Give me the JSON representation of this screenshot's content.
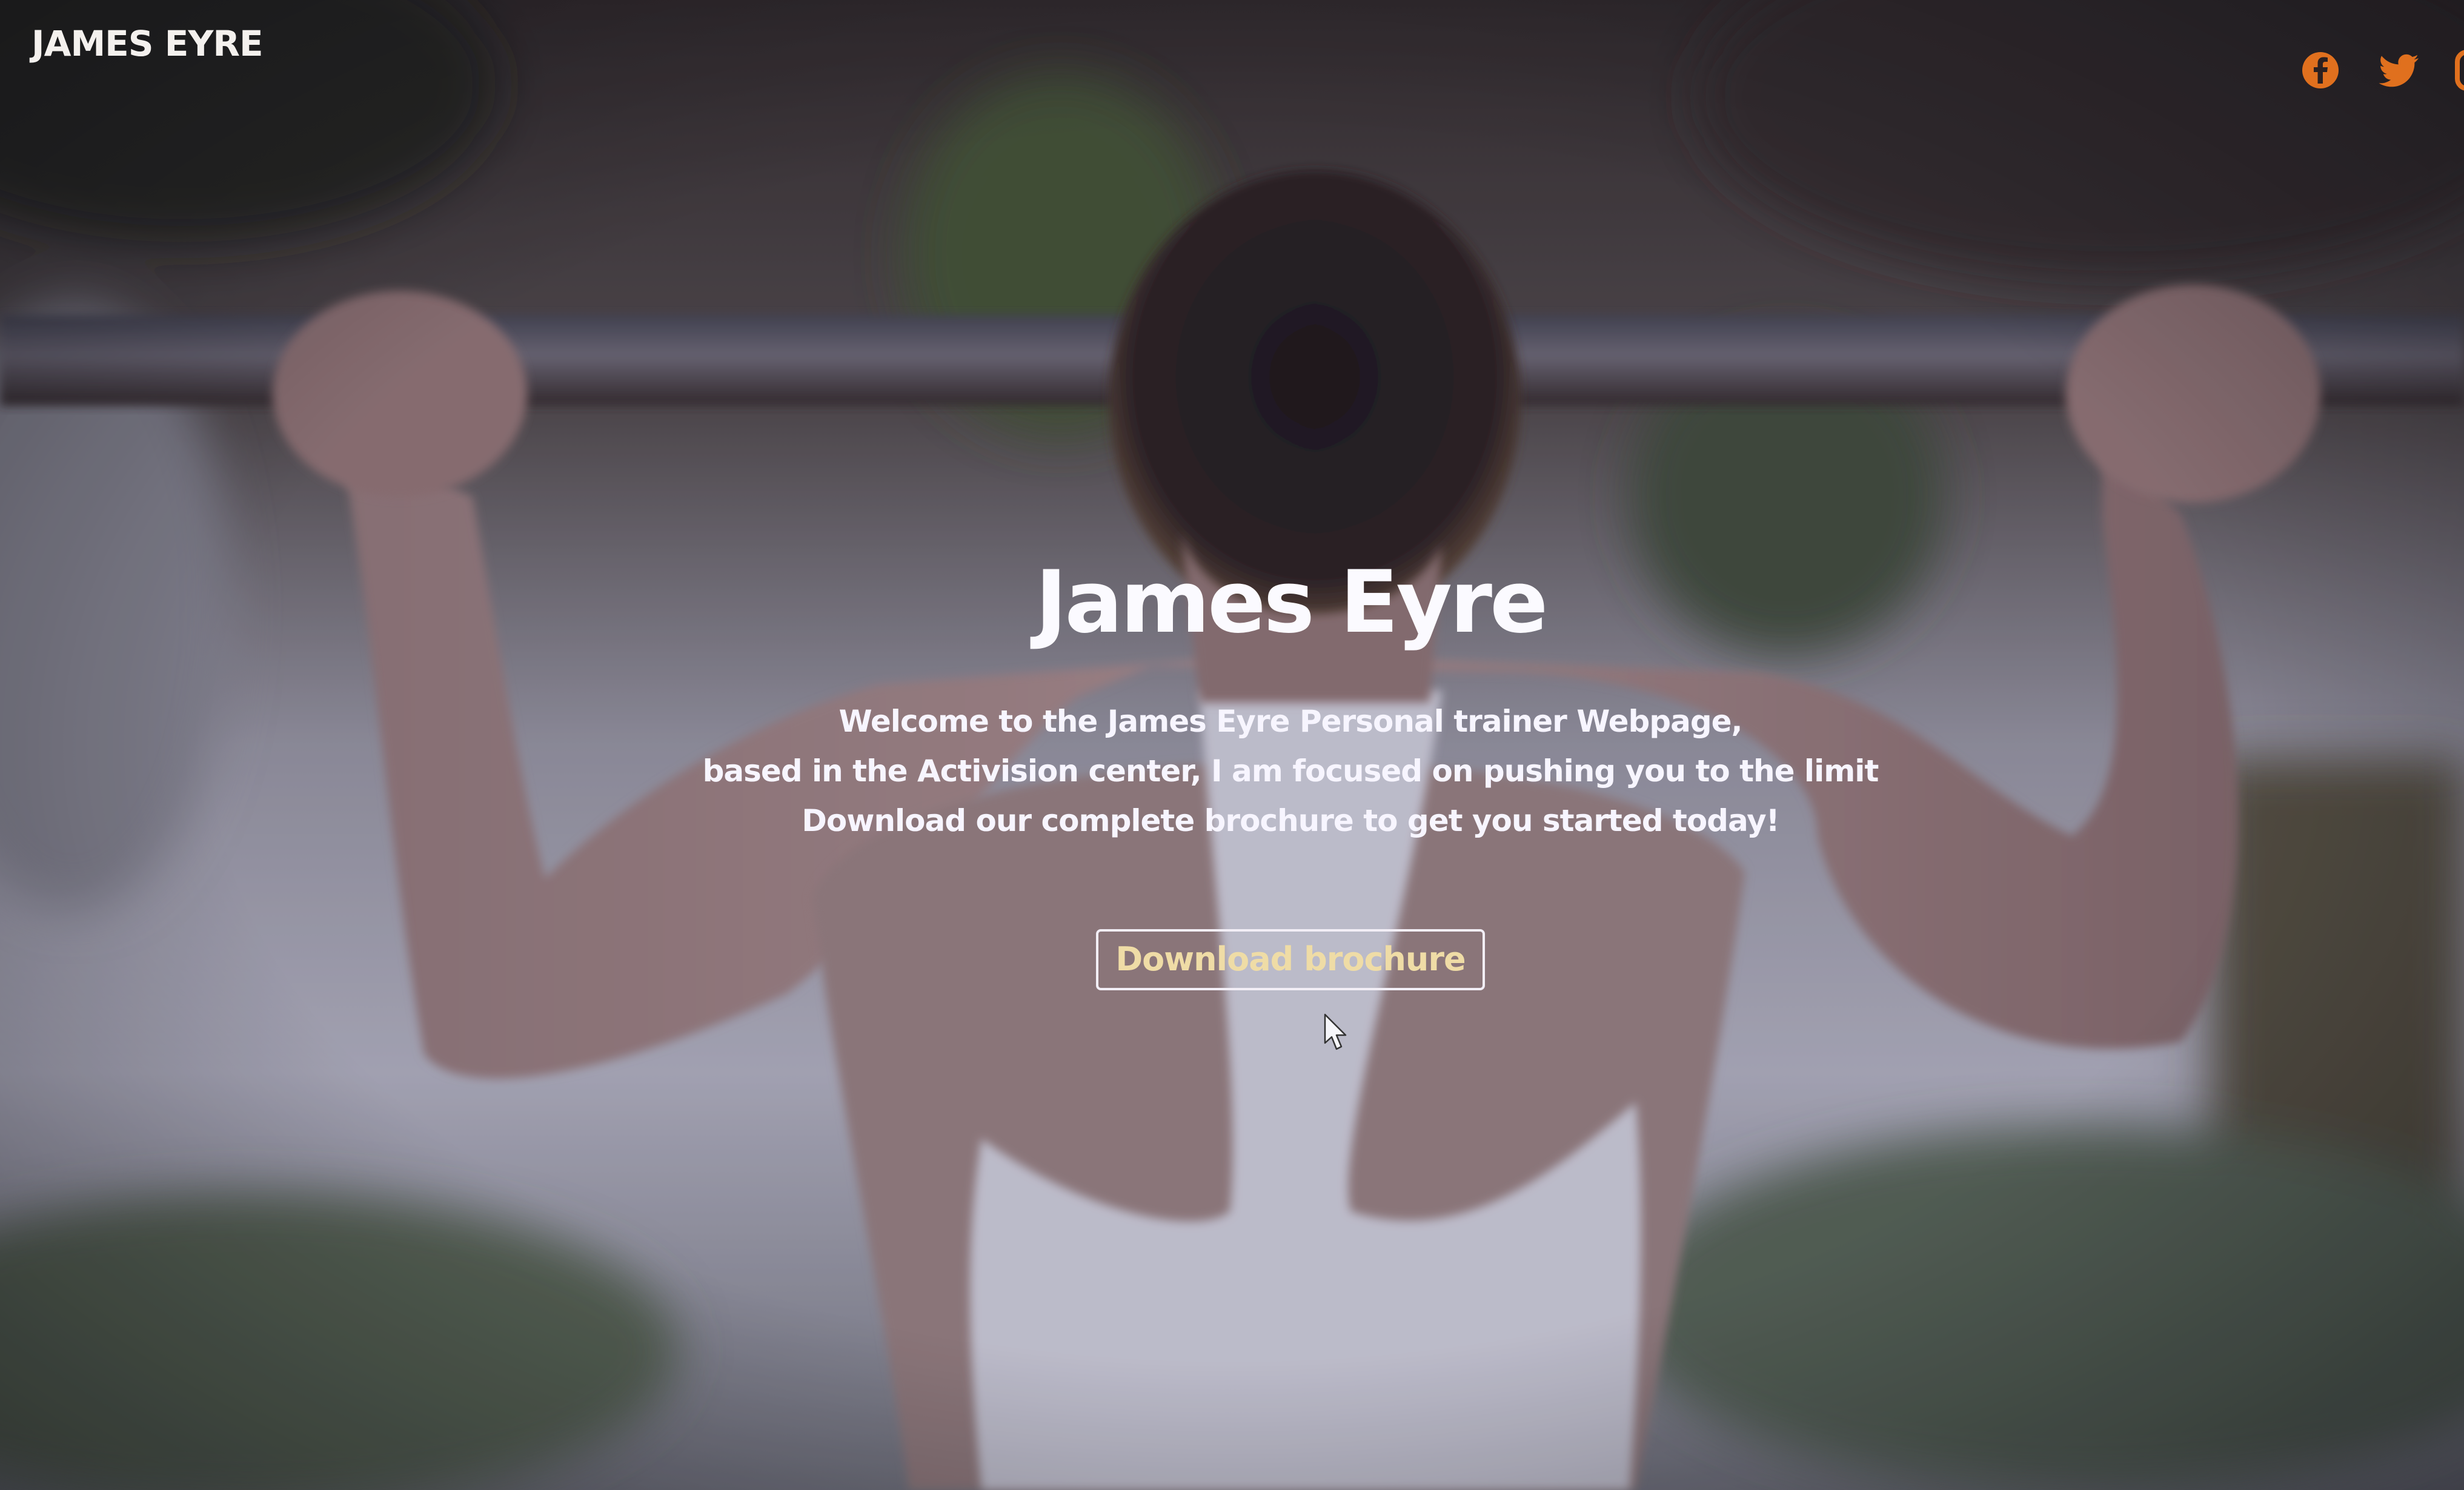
{
  "header": {
    "brand": "JAMES EYRE",
    "social": [
      {
        "network": "facebook",
        "icon": "facebook-icon"
      },
      {
        "network": "twitter",
        "icon": "twitter-icon"
      },
      {
        "network": "instagram",
        "icon": "instagram-icon"
      }
    ],
    "icon_color": "#e0701e"
  },
  "hero": {
    "title": "James Eyre",
    "lines": [
      "Welcome to the James Eyre Personal trainer Webpage,",
      "based in the Activision center, I am focused on pushing you to the limit",
      "Download our complete brochure to get you started today!"
    ],
    "cta_label": "Download brochure",
    "cta_text_color": "#efdca6"
  }
}
